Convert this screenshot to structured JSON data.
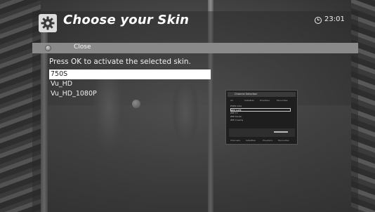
{
  "header": {
    "title": "Choose your Skin",
    "icon": "gear-icon",
    "clock_icon": "clock-icon",
    "time": "23:01"
  },
  "actions": {
    "close_label": "Close"
  },
  "instruction": "Press OK to activate the selected skin.",
  "skins": [
    {
      "label": "750S",
      "selected": true
    },
    {
      "label": "Vu_HD",
      "selected": false
    },
    {
      "label": "Vu_HD_1080P",
      "selected": false
    }
  ],
  "preview": {
    "title": "Channel Selection",
    "tabs": [
      "All",
      "Satellites",
      "Providers",
      "Favourites"
    ],
    "channels": [
      "ESPN India",
      "ZEE CAFE",
      "ZEE TV",
      "ZEE Studio",
      "ZEE Cinema"
    ],
    "buttons": [
      "Channels",
      "Satellites",
      "Providers",
      "Favourites"
    ]
  },
  "colors": {
    "accent_bar": "#8a8a8a",
    "selection": "#ffffff"
  }
}
